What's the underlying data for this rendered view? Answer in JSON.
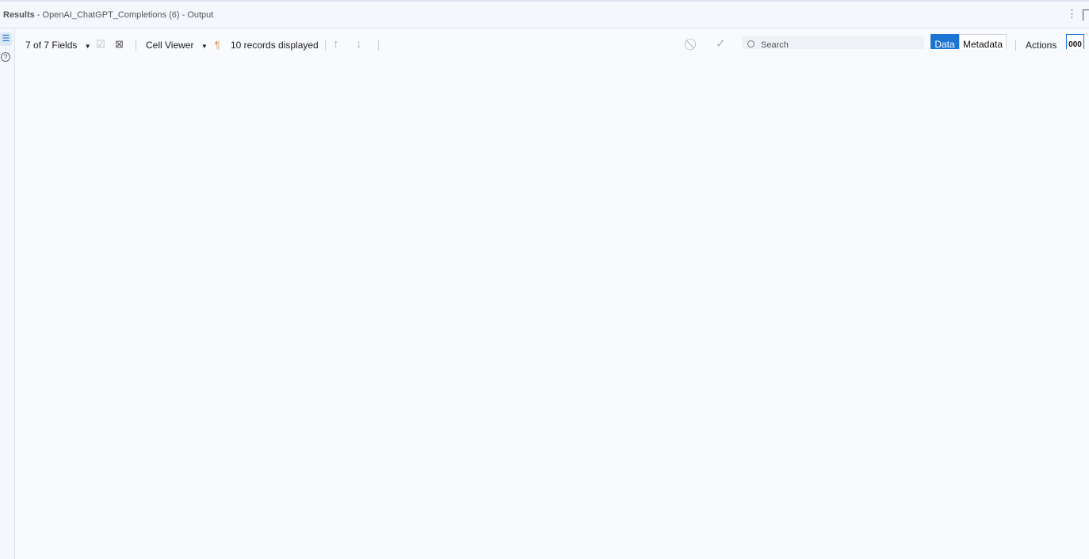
{
  "titlebar": {
    "title": "Results",
    "subtitle": " - OpenAI_ChatGPT_Completions (6) - Output"
  },
  "toolbar": {
    "fields_label": "7 of 7 Fields",
    "cell_viewer_label": "Cell Viewer",
    "records_label": "10 records displayed",
    "search_placeholder": "Search",
    "data_label": "Data",
    "metadata_label": "Metadata",
    "actions_label": "Actions",
    "format_label": "000"
  },
  "colors": {
    "accent": "#1b73d3"
  }
}
